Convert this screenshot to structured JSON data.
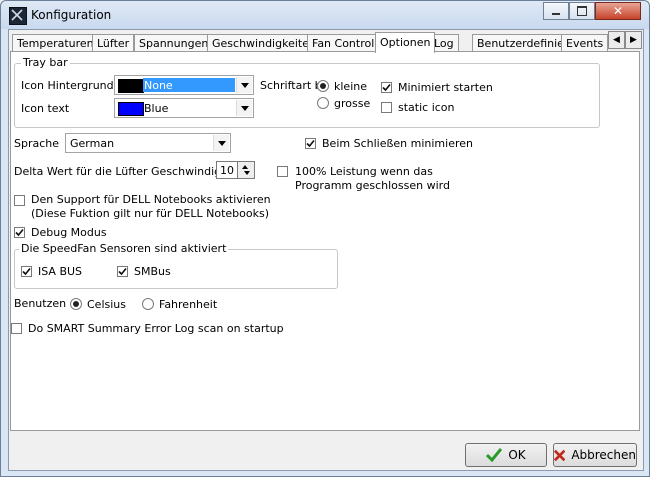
{
  "window": {
    "title": "Konfiguration"
  },
  "tabs": [
    "Temperaturen",
    "Lüfter",
    "Spannungen",
    "Geschwindigkeiten",
    "Fan Control",
    "Optionen",
    "Log",
    "Benutzerdefiniert",
    "Events"
  ],
  "active_tab": "Optionen",
  "tray_bar": {
    "title": "Tray bar",
    "icon_background_label": "Icon Hintergrund",
    "icon_background_value": "None",
    "icon_text_label": "Icon text",
    "icon_text_value": "Blue",
    "icon_text_color": "#0000ff",
    "font_label": "Schriftart b",
    "font_small": "kleine",
    "font_large": "grosse",
    "font_selected": "kleine",
    "minimized_start_label": "Minimiert starten",
    "minimized_start_checked": true,
    "static_icon_label": "static icon",
    "static_icon_checked": false
  },
  "language": {
    "label": "Sprache",
    "value": "German"
  },
  "minimize_on_close": {
    "label": "Beim Schließen minimieren",
    "checked": true
  },
  "delta": {
    "label": "Delta Wert für die Lüfter Geschwindigkeit",
    "value": "10"
  },
  "full_power": {
    "line1": "100% Leistung wenn das",
    "line2": "Programm geschlossen wird",
    "checked": false
  },
  "dell": {
    "line1": "Den Support für DELL Notebooks aktivieren",
    "line2": "(Diese Fuktion gilt nur für DELL Notebooks)",
    "checked": false
  },
  "debug": {
    "label": "Debug Modus",
    "checked": true
  },
  "sensors": {
    "title": "Die SpeedFan Sensoren sind aktiviert",
    "isa_label": "ISA BUS",
    "isa_checked": true,
    "smbus_label": "SMBus",
    "smbus_checked": true
  },
  "units": {
    "label": "Benutzen",
    "celsius": "Celsius",
    "fahrenheit": "Fahrenheit",
    "selected": "Celsius"
  },
  "smart": {
    "label": "Do SMART Summary Error Log scan on startup",
    "checked": false
  },
  "buttons": {
    "ok": "OK",
    "cancel": "Abbrechen"
  },
  "colors": {
    "selection": "#3399ff",
    "ok_icon": "#2a9a2a",
    "cancel_icon": "#c0281b"
  }
}
